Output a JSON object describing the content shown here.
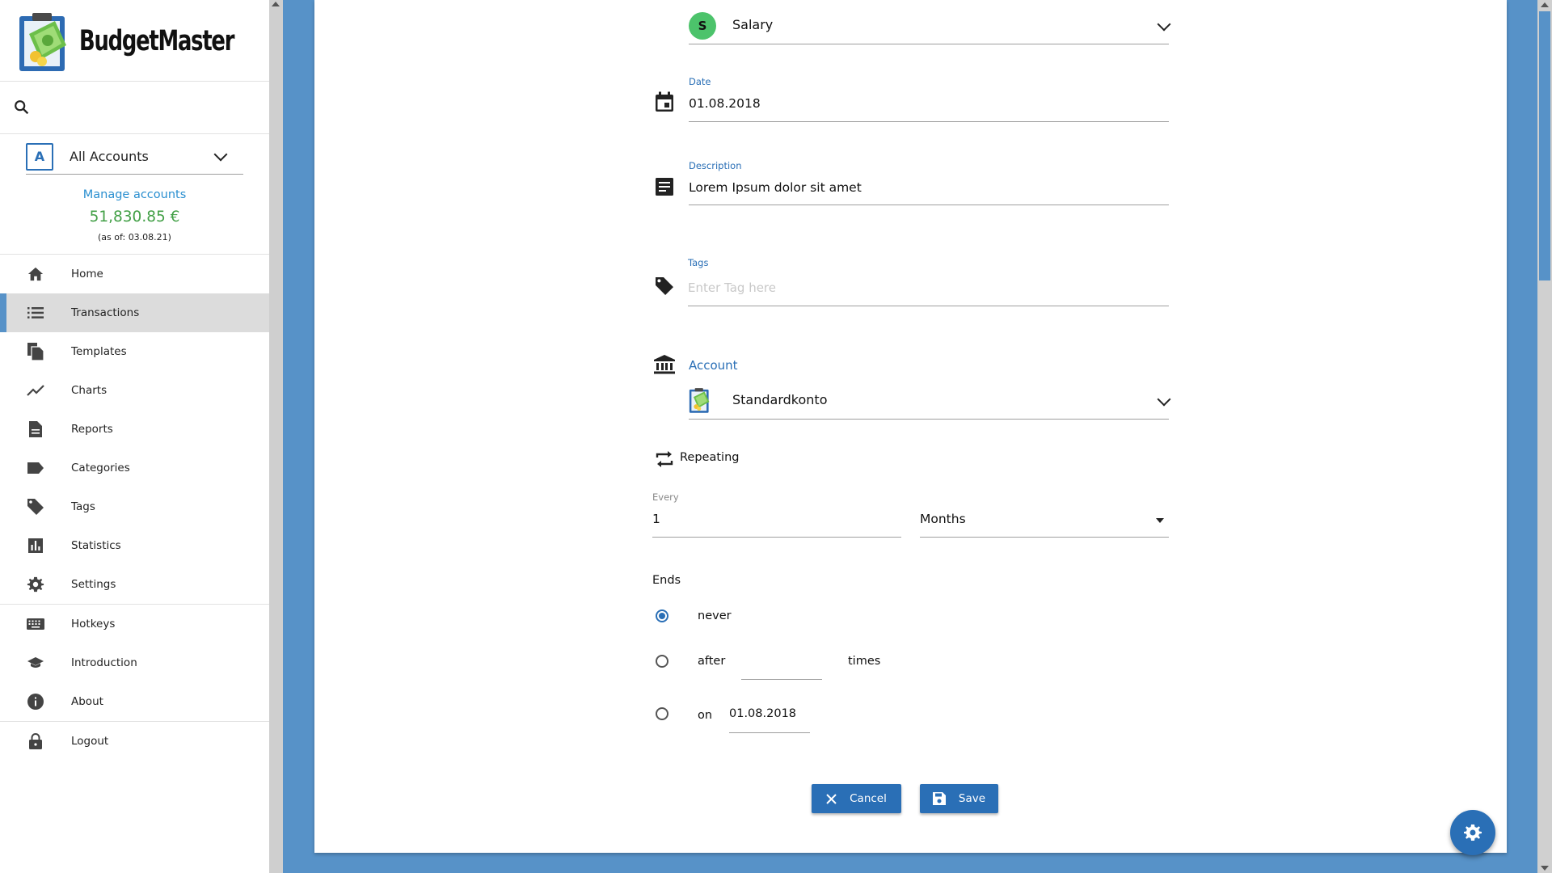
{
  "app": {
    "name": "BudgetMaster"
  },
  "sidebar": {
    "account_selector": {
      "badge": "A",
      "label": "All Accounts"
    },
    "manage_accounts": "Manage accounts",
    "balance": "51,830.85 €",
    "as_of": "(as of: 03.08.21)",
    "items": [
      {
        "label": "Home",
        "icon": "home-icon"
      },
      {
        "label": "Transactions",
        "icon": "list-icon",
        "active": true
      },
      {
        "label": "Templates",
        "icon": "file-copy-icon"
      },
      {
        "label": "Charts",
        "icon": "line-chart-icon"
      },
      {
        "label": "Reports",
        "icon": "description-icon"
      },
      {
        "label": "Categories",
        "icon": "label-icon"
      },
      {
        "label": "Tags",
        "icon": "tag-icon"
      },
      {
        "label": "Statistics",
        "icon": "bar-chart-icon"
      },
      {
        "label": "Settings",
        "icon": "gear-icon"
      },
      {
        "label": "Hotkeys",
        "icon": "keyboard-icon"
      },
      {
        "label": "Introduction",
        "icon": "school-icon"
      },
      {
        "label": "About",
        "icon": "info-icon"
      },
      {
        "label": "Logout",
        "icon": "lock-icon"
      }
    ]
  },
  "form": {
    "category": {
      "badge": "S",
      "label": "Salary"
    },
    "date": {
      "label": "Date",
      "value": "01.08.2018"
    },
    "description": {
      "label": "Description",
      "value": "Lorem Ipsum dolor sit amet"
    },
    "tags": {
      "label": "Tags",
      "placeholder": "Enter Tag here"
    },
    "account": {
      "label": "Account",
      "value": "Standardkonto"
    },
    "repeating": {
      "label": "Repeating",
      "every_label": "Every",
      "every_value": "1",
      "unit": "Months",
      "ends_label": "Ends",
      "never_label": "never",
      "after_label": "after",
      "times_label": "times",
      "on_label": "on",
      "on_value": "01.08.2018",
      "selected": "never"
    },
    "cancel_label": "Cancel",
    "save_label": "Save"
  },
  "colors": {
    "accent": "#2a6fb6",
    "background": "#5792c8",
    "balance": "#43a047",
    "category_badge": "#4cc36b"
  }
}
